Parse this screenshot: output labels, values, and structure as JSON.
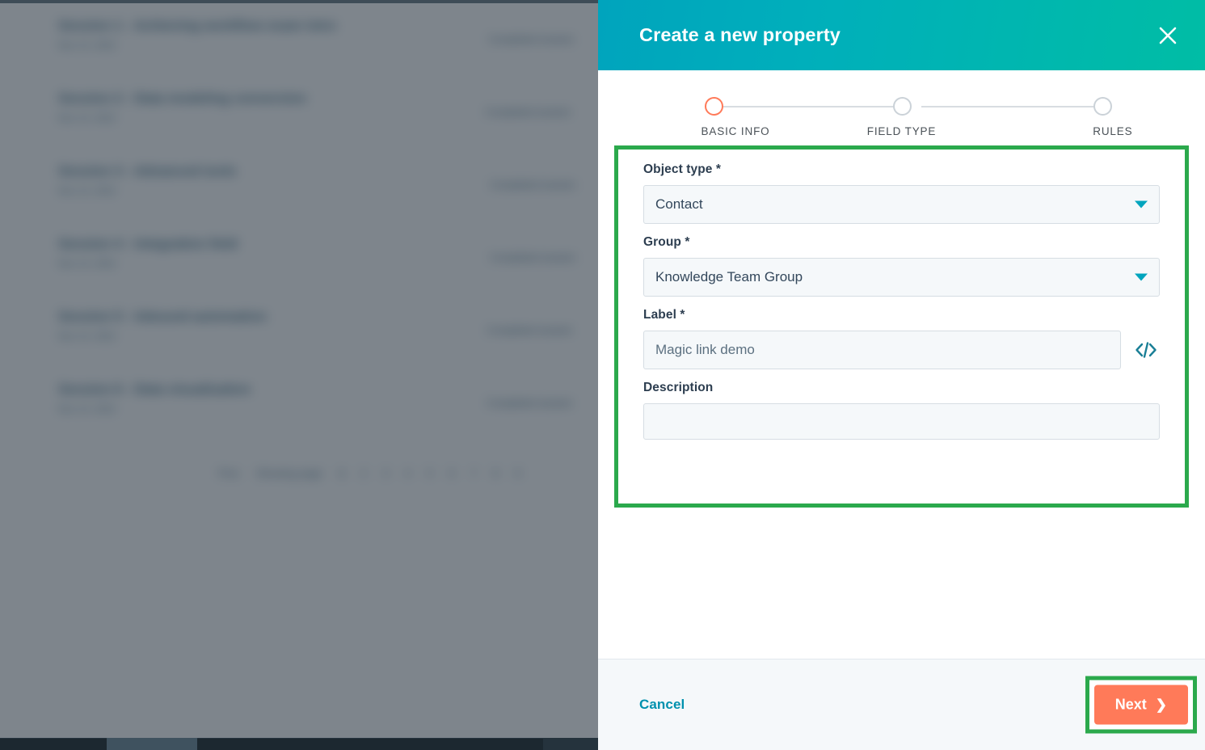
{
  "modal": {
    "title": "Create a new property",
    "close_icon": "close-icon",
    "steps": [
      {
        "label": "BASIC INFO",
        "active": true
      },
      {
        "label": "FIELD TYPE",
        "active": false
      },
      {
        "label": "RULES",
        "active": false
      }
    ],
    "form": {
      "object_type": {
        "label": "Object type *",
        "value": "Contact",
        "caret_icon": "chevron-down-icon"
      },
      "group": {
        "label": "Group *",
        "value": "Knowledge Team Group",
        "caret_icon": "chevron-down-icon"
      },
      "label_field": {
        "label": "Label *",
        "value": "Magic link demo",
        "placeholder": "Magic link demo",
        "code_icon": "code-icon"
      },
      "description": {
        "label": "Description",
        "value": "",
        "placeholder": ""
      }
    },
    "footer": {
      "cancel_label": "Cancel",
      "next_label": "Next",
      "next_chevron_icon": "chevron-right-icon"
    }
  },
  "background": {
    "rows": [
      {
        "title": "Session 1 - Achieving workflow exam intro",
        "sub": "Nov 14, 2022"
      },
      {
        "title": "Session 2 - Data modeling conversion",
        "sub": "Nov 14, 2022"
      },
      {
        "title": "Session 3 - Advanced tools",
        "sub": "Nov 14, 2022"
      },
      {
        "title": "Session 4 - Integration field",
        "sub": "Nov 14, 2022"
      },
      {
        "title": "Session 5 - Inbound automation",
        "sub": "Nov 14, 2022"
      },
      {
        "title": "Session 6 - Data visualization",
        "sub": "Nov 14, 2022"
      }
    ],
    "right_column": [
      "Completed session",
      "Completed session",
      "Completed session",
      "Completed session",
      "Completed session",
      "Completed session"
    ],
    "pager": [
      "Prev",
      "Showing page",
      "1",
      "2",
      "3",
      "4",
      "5",
      "6",
      "7",
      "8",
      "9",
      "Next"
    ]
  },
  "colors": {
    "header_gradient_start": "#00A4BD",
    "header_gradient_end": "#00BDA5",
    "highlight_green": "#2BA94C",
    "primary_orange": "#FF7A59",
    "link_teal": "#0091ae",
    "caret_teal": "#00A4BD"
  }
}
